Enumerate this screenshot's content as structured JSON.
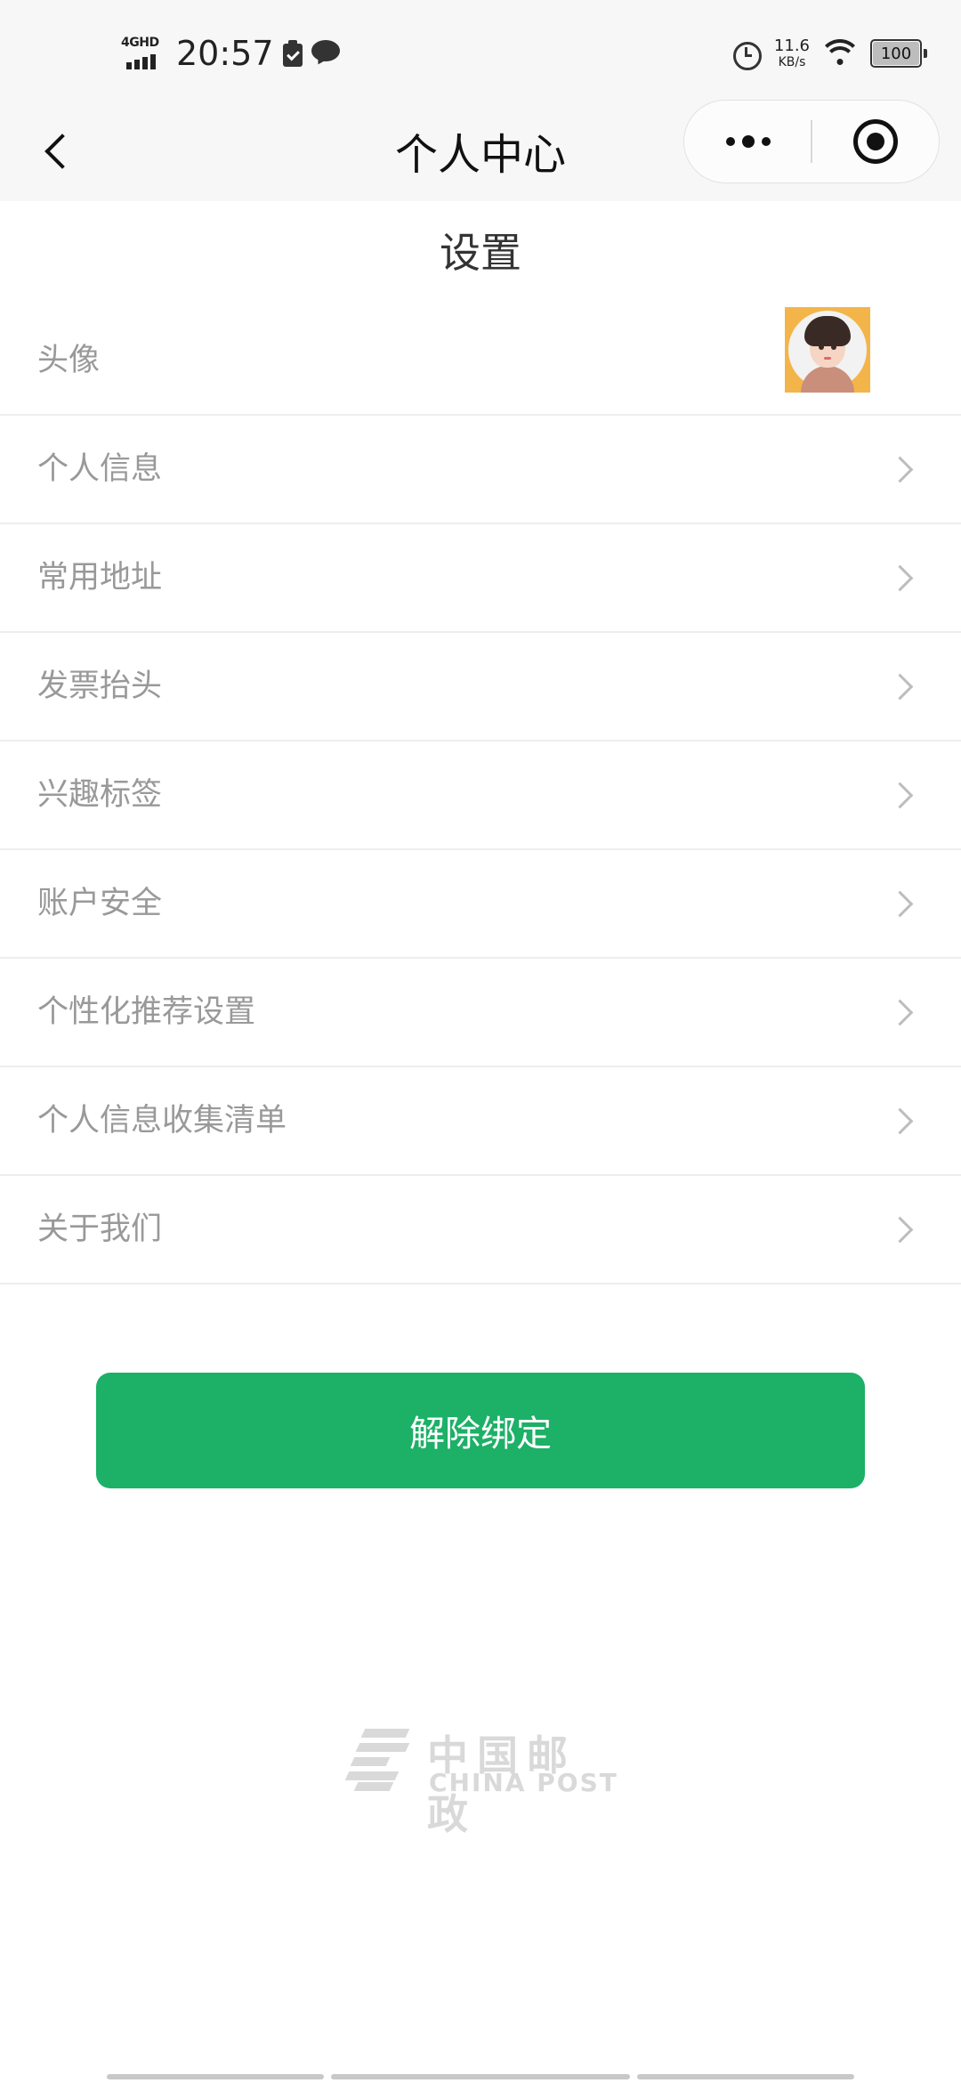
{
  "status_bar": {
    "network": "4GHD",
    "time": "20:57",
    "speed_value": "11.6",
    "speed_unit": "KB/s",
    "battery": "100"
  },
  "nav": {
    "title": "个人中心"
  },
  "page": {
    "section_title": "设置"
  },
  "settings": {
    "avatar_label": "头像",
    "items": [
      {
        "label": "个人信息"
      },
      {
        "label": "常用地址"
      },
      {
        "label": "发票抬头"
      },
      {
        "label": "兴趣标签"
      },
      {
        "label": "账户安全"
      },
      {
        "label": "个性化推荐设置"
      },
      {
        "label": "个人信息收集清单"
      },
      {
        "label": "关于我们"
      }
    ]
  },
  "actions": {
    "unbind_label": "解除绑定"
  },
  "footer": {
    "logo_cn": "中国邮政",
    "logo_en": "CHINA POST"
  },
  "colors": {
    "accent": "#1db067",
    "label_gray": "#999999",
    "header_bg": "#f7f7f7"
  }
}
